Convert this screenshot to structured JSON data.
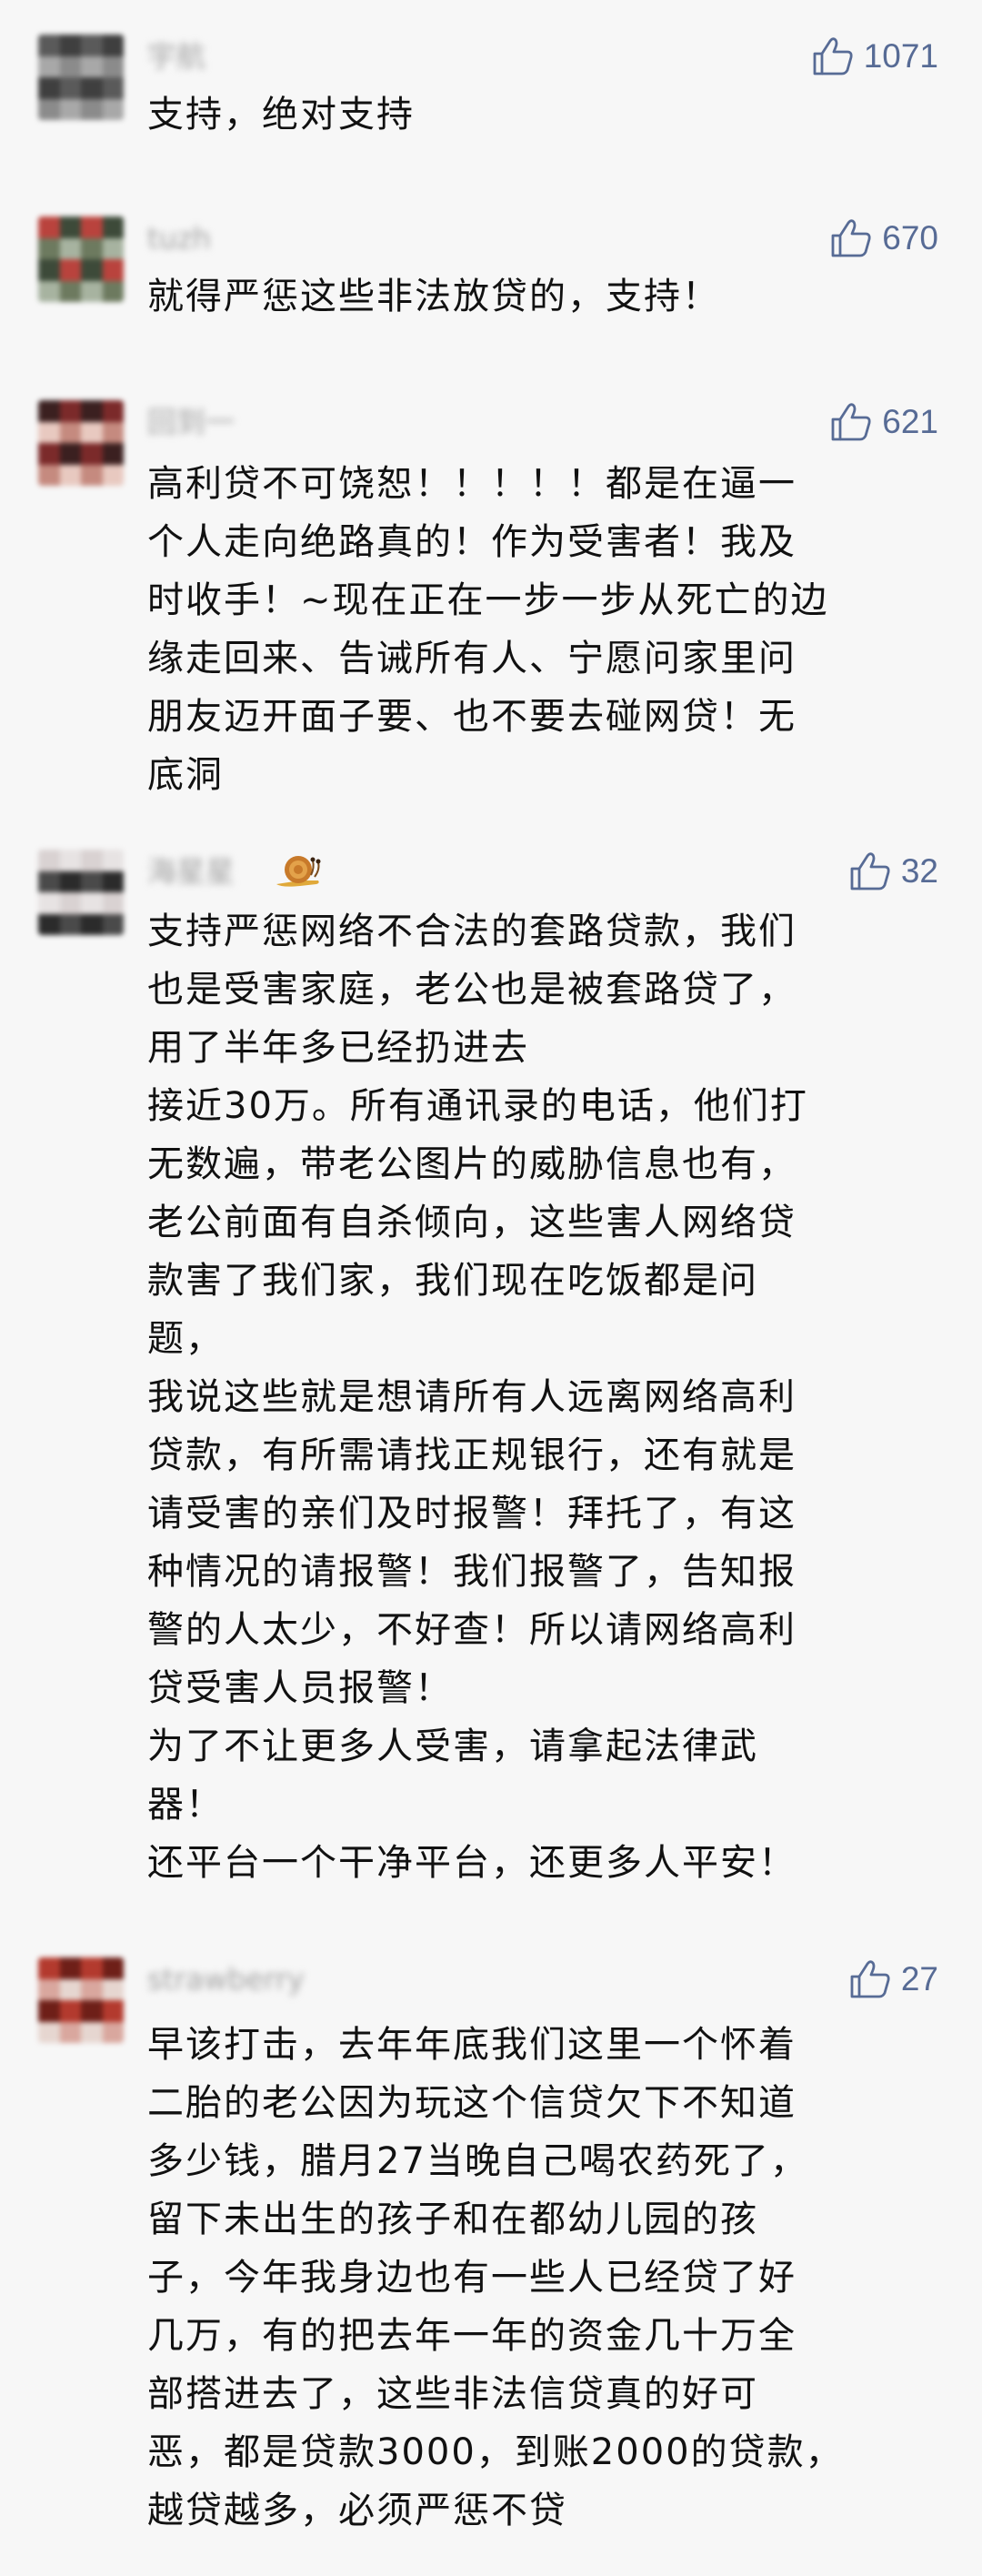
{
  "comments": [
    {
      "username": "宇航",
      "likes": "1071",
      "lines": [
        "支持，绝对支持"
      ],
      "avatar_colors": [
        "#5a5a5a",
        "#8b8b8b",
        "#3f3f3f",
        "#a8a8a8"
      ]
    },
    {
      "username": "tuzh",
      "likes": "670",
      "lines": [
        "就得严惩这些非法放贷的，支持！"
      ],
      "avatar_colors": [
        "#6d7a5f",
        "#b9433d",
        "#a7b3a0",
        "#3d4a39"
      ]
    },
    {
      "username": "回到一",
      "likes": "621",
      "lines": [
        "高利贷不可饶恕！！！！！都是在逼一",
        "个人走向绝路真的！作为受害者！我及",
        "时收手！~现在正在一步一步从死亡的边",
        "缘走回来、告诫所有人、宁愿问家里问",
        "朋友迈开面子要、也不要去碰网贷！无",
        "底洞"
      ],
      "avatar_colors": [
        "#7b2a2a",
        "#e8c9c0",
        "#3b2020",
        "#c58a7f"
      ]
    },
    {
      "username": "海星星",
      "likes": "32",
      "has_badge": true,
      "badge_icon": "snail-icon",
      "lines": [
        "支持严惩网络不合法的套路贷款，我们",
        "也是受害家庭，老公也是被套路贷了，",
        "用了半年多已经扔进去",
        "接近30万。所有通讯录的电话，他们打",
        "无数遍，带老公图片的威胁信息也有，",
        "老公前面有自杀倾向，这些害人网络贷",
        "款害了我们家，我们现在吃饭都是问",
        "题，",
        "我说这些就是想请所有人远离网络高利",
        "贷款，有所需请找正规银行，还有就是",
        "请受害的亲们及时报警！拜托了，有这",
        "种情况的请报警！我们报警了，告知报",
        "警的人太少，不好查！所以请网络高利",
        "贷受害人员报警！",
        "为了不让更多人受害，请拿起法律武",
        "器！",
        "还平台一个干净平台，还更多人平安！"
      ],
      "avatar_colors": [
        "#2b2b2b",
        "#e7e3e3",
        "#4a4a4a",
        "#d9d2d2"
      ]
    },
    {
      "username": "strawberry",
      "likes": "27",
      "lines": [
        "早该打击，去年年底我们这里一个怀着",
        "二胎的老公因为玩这个信贷欠下不知道",
        "多少钱，腊月27当晚自己喝农药死了，",
        "留下未出生的孩子和在都幼儿园的孩",
        "子，今年我身边也有一些人已经贷了好",
        "几万，有的把去年一年的资金几十万全",
        "部搭进去了，这些非法信贷真的好可",
        "恶，都是贷款3000，到账2000的贷款，",
        "越贷越多，必须严惩不贷"
      ],
      "avatar_colors": [
        "#b33a2e",
        "#e6d6d0",
        "#6e1f18",
        "#d9a79e"
      ]
    }
  ],
  "like_color": "#576b95",
  "like_icon": "thumbs-up-icon"
}
